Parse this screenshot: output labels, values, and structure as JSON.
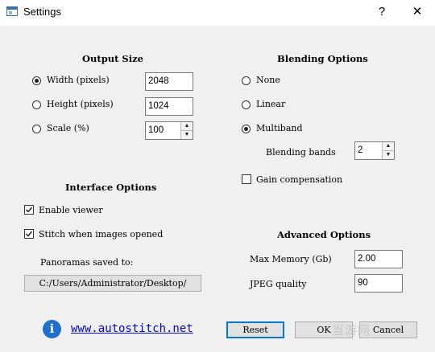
{
  "window": {
    "title": "Settings",
    "help_glyph": "?",
    "close_glyph": "✕"
  },
  "output_size": {
    "heading": "Output Size",
    "width": {
      "label": "Width (pixels)",
      "value": "2048",
      "selected": true
    },
    "height": {
      "label": "Height (pixels)",
      "value": "1024",
      "selected": false
    },
    "scale": {
      "label": "Scale (%)",
      "value": "100",
      "selected": false
    }
  },
  "blending": {
    "heading": "Blending Options",
    "options": [
      {
        "label": "None",
        "selected": false
      },
      {
        "label": "Linear",
        "selected": false
      },
      {
        "label": "Multiband",
        "selected": true
      }
    ],
    "bands_label": "Blending bands",
    "bands_value": "2",
    "gain_label": "Gain compensation",
    "gain_checked": false
  },
  "interface": {
    "heading": "Interface Options",
    "enable_viewer_label": "Enable viewer",
    "enable_viewer_checked": true,
    "stitch_label": "Stitch when images opened",
    "stitch_checked": true,
    "saved_to_label": "Panoramas saved to:",
    "saved_path": "C:/Users/Administrator/Desktop/"
  },
  "advanced": {
    "heading": "Advanced Options",
    "max_memory_label": "Max Memory (Gb)",
    "max_memory_value": "2.00",
    "jpeg_label": "JPEG quality",
    "jpeg_value": "90"
  },
  "footer": {
    "info_glyph": "i",
    "link_text": "www.autostitch.net",
    "reset_label": "Reset",
    "ok_label": "OK",
    "cancel_label": "Cancel"
  },
  "watermark": "当游网"
}
